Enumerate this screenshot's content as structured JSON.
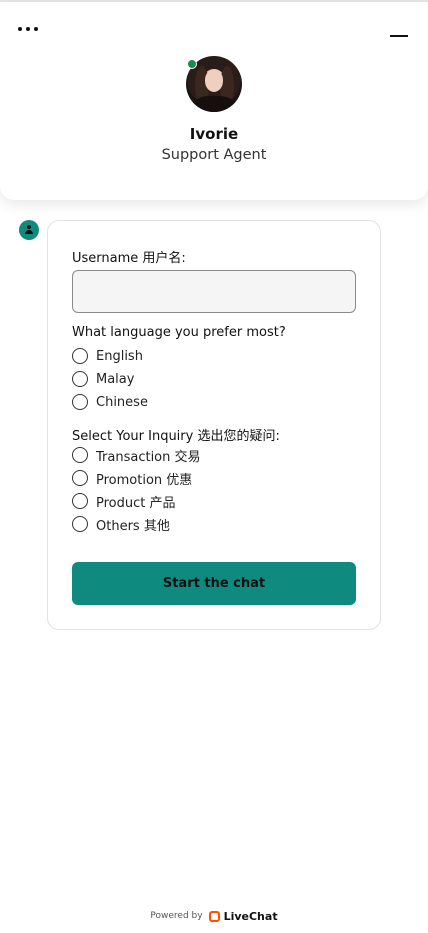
{
  "header": {
    "agent_name": "Ivorie",
    "agent_role": "Support Agent",
    "online_color": "#1e8a4c"
  },
  "form": {
    "username_label": "Username 用户名:",
    "username_value": "",
    "username_placeholder": "",
    "language_question": "What language you prefer most?",
    "language_options": [
      "English",
      "Malay",
      "Chinese"
    ],
    "inquiry_question": "Select Your Inquiry 选出您的疑问:",
    "inquiry_options": [
      "Transaction 交易",
      "Promotion 优惠",
      "Product 产品",
      "Others 其他"
    ],
    "submit_label": "Start the chat"
  },
  "footer": {
    "powered_by": "Powered by",
    "brand": "LiveChat"
  },
  "colors": {
    "accent": "#0f8a7e",
    "brand": "#ff5100"
  }
}
